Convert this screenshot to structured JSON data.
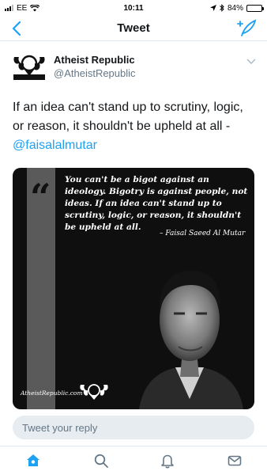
{
  "status_bar": {
    "carrier": "EE",
    "time": "10:11",
    "battery_percent": "84%",
    "battery_level": 0.84
  },
  "nav": {
    "title": "Tweet",
    "back_icon": "chevron-left-icon",
    "compose_icon": "compose-tweet-icon"
  },
  "tweet": {
    "author_name": "Atheist Republic",
    "author_handle": "@AtheistRepublic",
    "text": "If an idea can't stand up to scrutiny, logic, or reason, it shouldn't be upheld at all - ",
    "mention": "@faisalalmutar",
    "media": {
      "quote_mark": "“",
      "quote": "You can't be a bigot against an ideology. Bigotry is against people, not ideas. If an idea can't stand up to scrutiny, logic, or reason, it shouldn't be upheld at all.",
      "attribution": "– Faisal Saeed Al Mutar",
      "site": "AtheistRepublic.com",
      "logo_text": "Atheist Republic"
    }
  },
  "reply": {
    "placeholder": "Tweet your reply"
  },
  "tab_bar": {
    "items": [
      "home-icon",
      "search-icon",
      "notifications-icon",
      "messages-icon"
    ]
  },
  "colors": {
    "accent": "#1da1f2",
    "text": "#14171a",
    "secondary": "#657786"
  }
}
